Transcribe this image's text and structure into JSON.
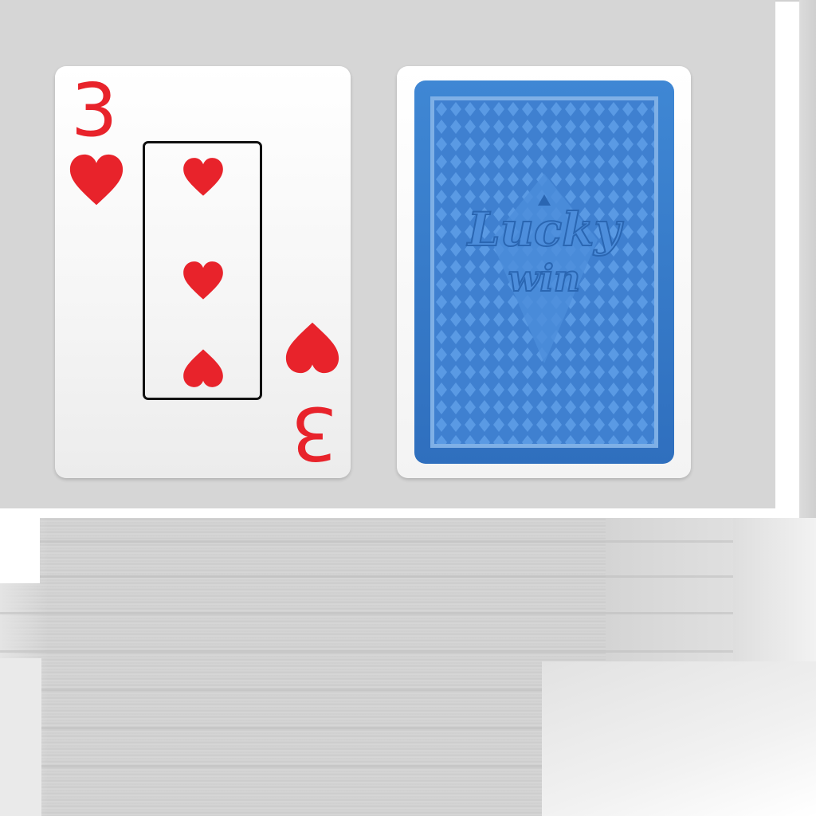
{
  "colors": {
    "table": "#d6d6d6",
    "hearts_red": "#e8232b",
    "card_back_blue": "#3f87d4",
    "card_back_border": "#7fb0e6"
  },
  "face_card": {
    "rank": "3",
    "suit": "hearts",
    "pip_count": 3,
    "corner_icon": "heart-icon",
    "highlighted": true
  },
  "back_card": {
    "logo_line1": "Lucky",
    "logo_line2": "win",
    "pattern_icon": "diamond-lattice-pattern"
  }
}
